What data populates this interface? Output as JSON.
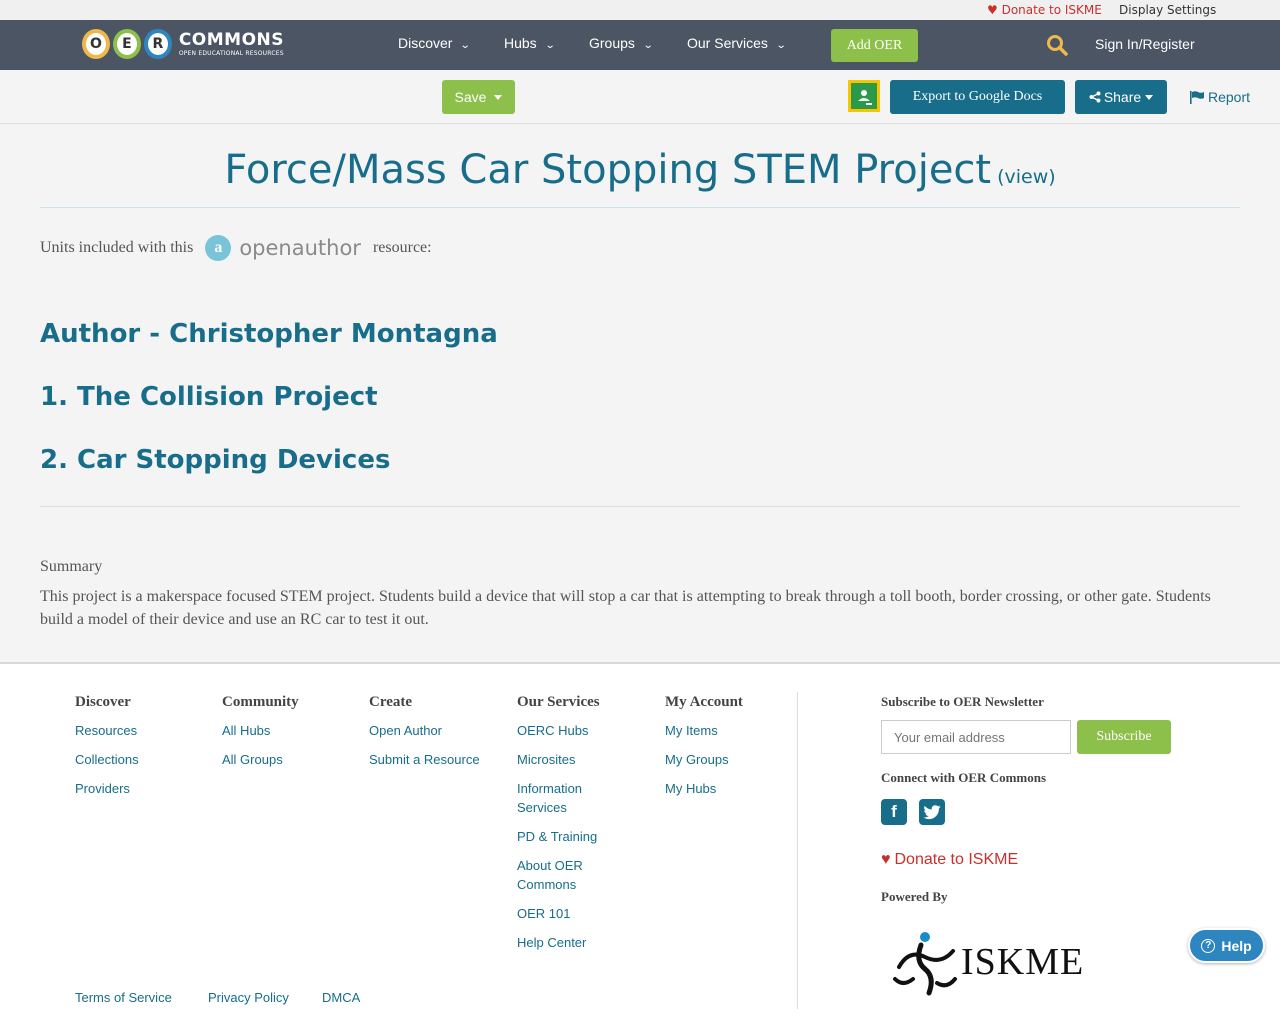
{
  "utility": {
    "donate": "Donate to ISKME",
    "display_settings": "Display Settings"
  },
  "logo": {
    "letters": [
      "O",
      "E",
      "R"
    ],
    "wordmark": "COMMONS",
    "tagline": "OPEN EDUCATIONAL RESOURCES"
  },
  "nav": {
    "items": [
      {
        "label": "Discover"
      },
      {
        "label": "Hubs"
      },
      {
        "label": "Groups"
      },
      {
        "label": "Our Services"
      }
    ],
    "add_oer": "Add OER",
    "sign_in": "Sign In/Register"
  },
  "toolbar": {
    "save": "Save",
    "export": "Export to Google Docs",
    "share": "Share",
    "report": "Report"
  },
  "resource": {
    "title": "Force/Mass Car Stopping STEM Project",
    "view_link": "(view)",
    "units_prefix": "Units included with this",
    "units_suffix": "resource:",
    "openauthor_logo": "openauthor",
    "units": [
      {
        "label": "Author - Christopher Montagna"
      },
      {
        "label": "1. The Collision Project"
      },
      {
        "label": "2. Car Stopping Devices"
      }
    ],
    "summary_heading": "Summary",
    "summary": "This project is a makerspace focused STEM project. Students build a device that will stop a car that is attempting to break through a toll booth, border crossing, or other gate. Students build a model of their device and use an RC car to test it out."
  },
  "footer": {
    "columns": [
      {
        "heading": "Discover",
        "links": [
          "Resources",
          "Collections",
          "Providers"
        ]
      },
      {
        "heading": "Community",
        "links": [
          "All Hubs",
          "All Groups"
        ]
      },
      {
        "heading": "Create",
        "links": [
          "Open Author",
          "Submit a Resource"
        ]
      },
      {
        "heading": "Our Services",
        "links": [
          "OERC Hubs",
          "Microsites",
          "Information Services",
          "PD & Training",
          "About OER Commons",
          "OER 101",
          "Help Center"
        ]
      },
      {
        "heading": "My Account",
        "links": [
          "My Items",
          "My Groups",
          "My Hubs"
        ]
      }
    ],
    "newsletter_heading": "Subscribe to OER Newsletter",
    "email_placeholder": "Your email address",
    "subscribe": "Subscribe",
    "connect_heading": "Connect with OER Commons",
    "donate": "Donate to ISKME",
    "powered_by": "Powered By",
    "iskme_logo": "ISKME",
    "legal": [
      "Terms of Service",
      "Privacy Policy",
      "DMCA"
    ]
  },
  "help": {
    "label": "Help"
  },
  "colors": {
    "nav_bg": "#4c5564",
    "accent_green": "#8cc04a",
    "link_blue": "#176d8a",
    "donate_red": "#c9302c"
  }
}
